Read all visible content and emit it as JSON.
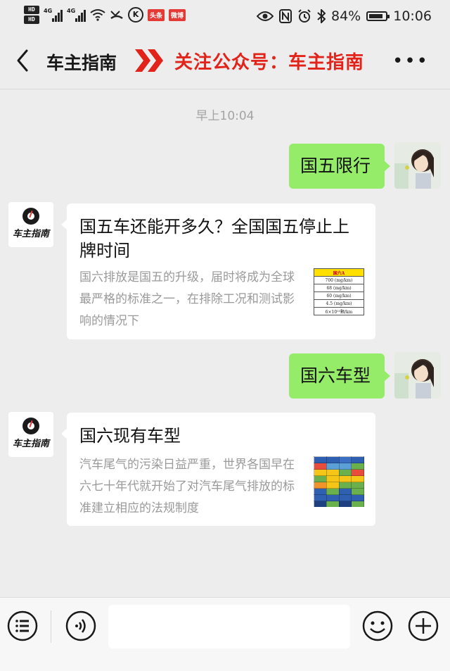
{
  "status_bar": {
    "network_1": "4G",
    "network_2": "4G",
    "badge_1": "头条",
    "badge_2": "微博",
    "battery": "84%",
    "time": "10:06",
    "hd_1": "HD",
    "hd_2": "HD"
  },
  "header": {
    "title": "车主指南",
    "follow_text": "关注公众号：车主指南",
    "more": "•••"
  },
  "chat": {
    "timestamp": "早上10:04",
    "messages": [
      {
        "type": "sent",
        "text": "国五限行"
      },
      {
        "type": "article",
        "title": "国五车还能开多久？全国国五停止上牌时间",
        "desc": "国六排放是国五的升级，届时将成为全球最严格的标准之一，在排除工况和测试影响的情况下",
        "thumb_table": {
          "header": "国六A",
          "rows": [
            "700 (mg/km)",
            "68 (mg/km)",
            "60 (mg/km)",
            "4.5 (mg/km)",
            "6×10¹¹颗/km"
          ]
        }
      },
      {
        "type": "sent",
        "text": "国六车型"
      },
      {
        "type": "article",
        "title": "国六现有车型",
        "desc": "汽车尾气的污染日益严重，世界各国早在六七十年代就开始了对汽车尾气排放的标准建立相应的法规制度"
      }
    ],
    "bot_name": "车主指南"
  },
  "input": {
    "placeholder": ""
  },
  "colors": {
    "sent_bubble": "#95ec69",
    "follow_red": "#e2231a",
    "background": "#ededed"
  },
  "icons": {
    "back": "chevron-left-icon",
    "menu": "list-menu-icon",
    "voice": "voice-icon",
    "emoji": "emoji-icon",
    "add": "plus-circle-icon"
  }
}
